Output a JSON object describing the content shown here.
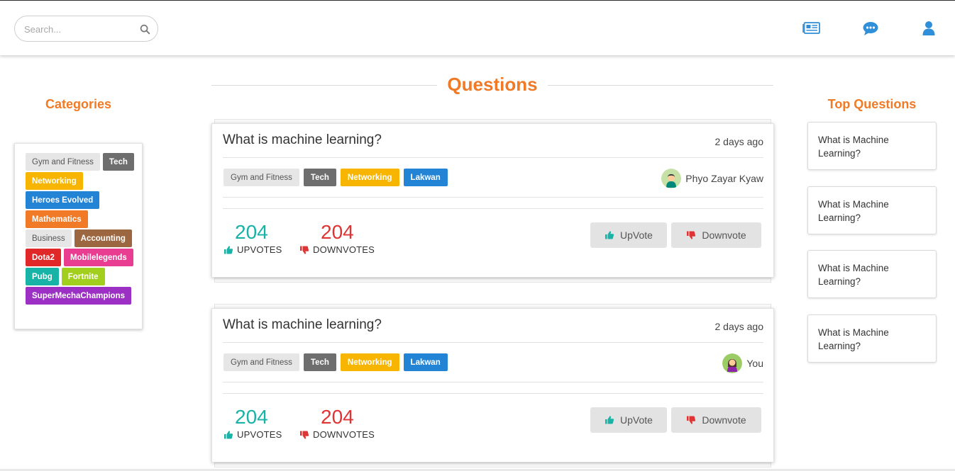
{
  "header": {
    "search_placeholder": "Search...",
    "icons": [
      "newspaper-icon",
      "chat-icon",
      "user-icon"
    ],
    "accent_color": "#2f8fd8"
  },
  "categories": {
    "title": "Categories",
    "items": [
      {
        "label": "Gym and Fitness",
        "color": "#e6e6e6"
      },
      {
        "label": "Tech",
        "color": "#6e6e6e"
      },
      {
        "label": "Networking",
        "color": "#f7b500"
      },
      {
        "label": "Heroes Evolved",
        "color": "#2384d6"
      },
      {
        "label": "Mathematics",
        "color": "#f07a26"
      },
      {
        "label": "Business",
        "color": "#e6e6e6"
      },
      {
        "label": "Accounting",
        "color": "#9b6640"
      },
      {
        "label": "Dota2",
        "color": "#e02828"
      },
      {
        "label": "Mobilelegends",
        "color": "#e93d91"
      },
      {
        "label": "Pubg",
        "color": "#16b3a6"
      },
      {
        "label": "Fortnite",
        "color": "#a2cf1e"
      },
      {
        "label": "SuperMechaChampions",
        "color": "#9c2fc4"
      }
    ]
  },
  "questions": {
    "title": "Questions",
    "cards": [
      {
        "title": "What is machine learning?",
        "time": "2 days ago",
        "tags": [
          {
            "label": "Gym and Fitness",
            "color": "#e6e6e6"
          },
          {
            "label": "Tech",
            "color": "#6e6e6e"
          },
          {
            "label": "Networking",
            "color": "#f7b500"
          },
          {
            "label": "Lakwan",
            "color": "#2384d6"
          }
        ],
        "author": "Phyo Zayar Kyaw",
        "avatar_icon": "male-avatar-icon",
        "upvotes": "204",
        "upvotes_label": "UPVOTES",
        "downvotes": "204",
        "downvotes_label": "DOWNVOTES",
        "upvote_button": "UpVote",
        "downvote_button": "Downvote"
      },
      {
        "title": "What is machine learning?",
        "time": "2 days ago",
        "tags": [
          {
            "label": "Gym and Fitness",
            "color": "#e6e6e6"
          },
          {
            "label": "Tech",
            "color": "#6e6e6e"
          },
          {
            "label": "Networking",
            "color": "#f7b500"
          },
          {
            "label": "Lakwan",
            "color": "#2384d6"
          }
        ],
        "author": "You",
        "avatar_icon": "female-avatar-icon",
        "upvotes": "204",
        "upvotes_label": "UPVOTES",
        "downvotes": "204",
        "downvotes_label": "DOWNVOTES",
        "upvote_button": "UpVote",
        "downvote_button": "Downvote"
      }
    ]
  },
  "top_questions": {
    "title": "Top Questions",
    "items": [
      {
        "label": "What is Machine Learning?"
      },
      {
        "label": "What is Machine Learning?"
      },
      {
        "label": "What is Machine Learning?"
      },
      {
        "label": "What is Machine Learning?"
      }
    ]
  },
  "colors": {
    "accent_orange": "#f07a26",
    "upvote_teal": "#19b2a6",
    "downvote_red": "#e03434"
  }
}
